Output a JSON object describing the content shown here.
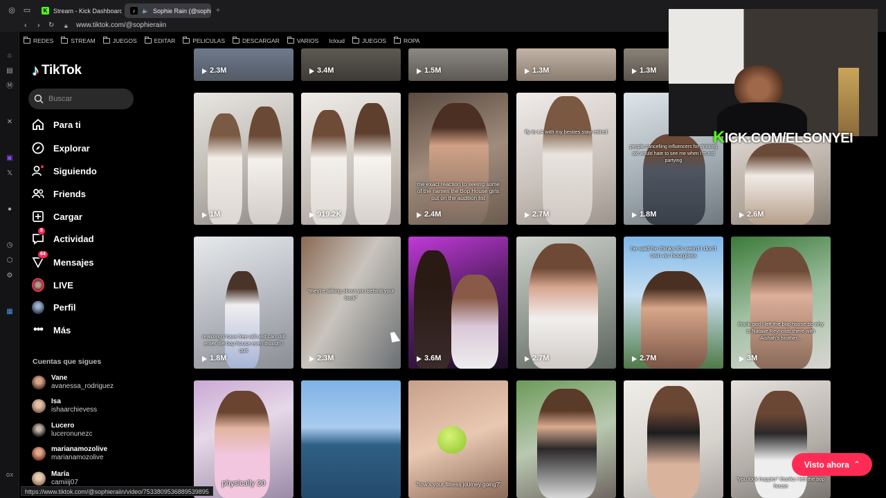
{
  "browser": {
    "tabs": [
      {
        "label": "Stream - Kick Dashboard",
        "active": false
      },
      {
        "label": "Sophie Rain (@sophie",
        "active": true
      }
    ],
    "url": "www.tiktok.com/@sophieraiin",
    "status_url": "https://www.tiktok.com/@sophieraiin/video/7533809536889539895",
    "bookmarks": [
      "REDES",
      "STREAM",
      "JUEGOS",
      "EDITAR",
      "PELICULAS",
      "DESCARGAR",
      "VARIOS",
      "Icloud",
      "JUEGOS",
      "ROPA"
    ],
    "sidebar_gx_label": "GX"
  },
  "tiktok": {
    "logo_text": "TikTok",
    "search_placeholder": "Buscar",
    "nav": [
      {
        "label": "Para ti",
        "icon": "home-icon"
      },
      {
        "label": "Explorar",
        "icon": "compass-icon"
      },
      {
        "label": "Siguiendo",
        "icon": "following-icon"
      },
      {
        "label": "Friends",
        "icon": "friends-icon"
      },
      {
        "label": "Cargar",
        "icon": "upload-icon"
      },
      {
        "label": "Actividad",
        "icon": "activity-icon",
        "badge": "9"
      },
      {
        "label": "Mensajes",
        "icon": "messages-icon",
        "badge": "64"
      },
      {
        "label": "LIVE",
        "icon": "live-icon"
      },
      {
        "label": "Perfil",
        "icon": "profile-icon"
      },
      {
        "label": "Más",
        "icon": "more-icon"
      }
    ],
    "following_title": "Cuentas que sigues",
    "following": [
      {
        "name": "Vane",
        "handle": "avanessa_rodriguez"
      },
      {
        "name": "Isa",
        "handle": "ishaarchievess"
      },
      {
        "name": "Lucero",
        "handle": "luceronunezc"
      },
      {
        "name": "marianamozolive",
        "handle": "marianamozolive"
      },
      {
        "name": "María",
        "handle": "camiiij07"
      }
    ]
  },
  "videos": {
    "row0": [
      "2.3M",
      "3.4M",
      "1.5M",
      "1.3M",
      "1.3M"
    ],
    "row1": [
      {
        "views": "1M",
        "caption": ""
      },
      {
        "views": "919.2K",
        "caption": ""
      },
      {
        "views": "2.4M",
        "caption": "me exact reaction to seeing some of the names the Bop House girls put on the audition list"
      },
      {
        "views": "2.7M",
        "caption": "fly to LA with my besties          stay retired"
      },
      {
        "views": "1.8M",
        "caption": "people cancelling influencers for drinking alc would hate to see me when I'm out partying"
      },
      {
        "views": "2.6M",
        "caption": ""
      }
    ],
    "row2": [
      {
        "views": "1.8M",
        "caption": "realizing I have free will and can still enter the bop house even though i quit"
      },
      {
        "views": "2.3M",
        "caption": "\"they're talking about you behind your back\""
      },
      {
        "views": "3.6M",
        "caption": ""
      },
      {
        "views": "2.7M",
        "caption": ""
      },
      {
        "views": "2.7M",
        "caption": "he said he thinks it's weird i don't own an hourglass"
      },
      {
        "views": "3M",
        "caption": "thank god i left the bop house bc why is Natalie Reynolds there with Aishah's brother..."
      }
    ],
    "row3": [
      {
        "caption": "physically 20"
      },
      {
        "caption": ""
      },
      {
        "caption": "\"how's your fitness journey going?\""
      },
      {
        "caption": ""
      },
      {
        "caption": ""
      },
      {
        "caption": "\"you look happier\" thanks i left the bop house"
      }
    ]
  },
  "stream": {
    "overlay_text": "KICK.COM/ELSONYEI",
    "overlay_k": "K",
    "overlay_rest": "ICK.COM/ELSONYEI"
  },
  "visto_ahora": "Visto ahora",
  "colors": {
    "accent": "#fe2c55",
    "kick_green": "#53fc18"
  }
}
